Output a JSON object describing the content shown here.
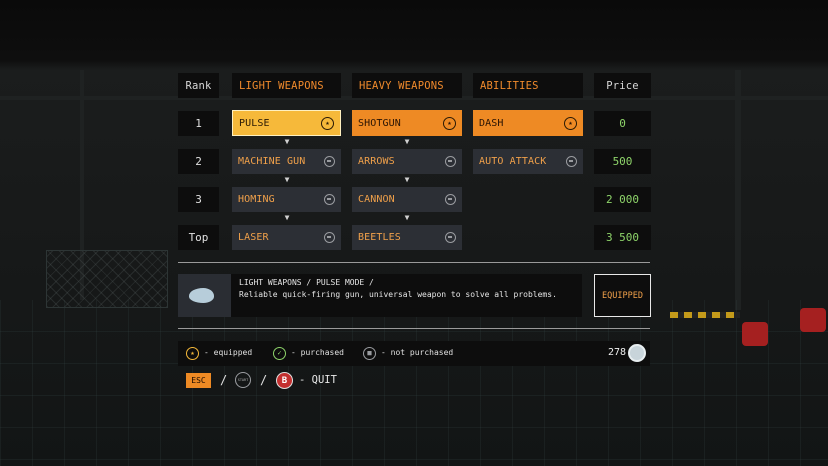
{
  "headers": {
    "rank": "Rank",
    "light": "LIGHT WEAPONS",
    "heavy": "HEAVY WEAPONS",
    "abilities": "ABILITIES",
    "price": "Price"
  },
  "ranks": [
    "1",
    "2",
    "3",
    "Top"
  ],
  "prices": [
    "0",
    "500",
    "2 000",
    "3 500"
  ],
  "light_weapons": [
    {
      "label": "PULSE",
      "status": "equipped"
    },
    {
      "label": "MACHINE GUN",
      "status": "not purchased"
    },
    {
      "label": "HOMING",
      "status": "not purchased"
    },
    {
      "label": "LASER",
      "status": "not purchased"
    }
  ],
  "heavy_weapons": [
    {
      "label": "SHOTGUN",
      "status": "equipped"
    },
    {
      "label": "ARROWS",
      "status": "not purchased"
    },
    {
      "label": "CANNON",
      "status": "not purchased"
    },
    {
      "label": "BEETLES",
      "status": "not purchased"
    }
  ],
  "abilities": [
    {
      "label": "DASH",
      "status": "equipped"
    },
    {
      "label": "AUTO ATTACK",
      "status": "not purchased"
    }
  ],
  "description": {
    "title": "LIGHT WEAPONS / PULSE MODE /",
    "text": "Reliable quick-firing gun, universal weapon to solve all problems.",
    "button": "EQUIPPED"
  },
  "legend": {
    "equipped": "- equipped",
    "purchased": "- purchased",
    "not_purchased": "- not purchased"
  },
  "coins": "278",
  "controls": {
    "esc": "ESC",
    "slash": "/",
    "start": "START",
    "b": "B",
    "quit": "- QUIT"
  },
  "colors": {
    "accent_orange": "#ee8a24",
    "equipped_yellow": "#f6b93a",
    "price_green": "#8ed46a",
    "item_bg": "#2c2f35"
  },
  "icons": {
    "equipped": "star-circle-icon",
    "purchased": "check-circle-icon",
    "not_purchased": "lock-circle-icon",
    "currency": "coin-icon"
  }
}
